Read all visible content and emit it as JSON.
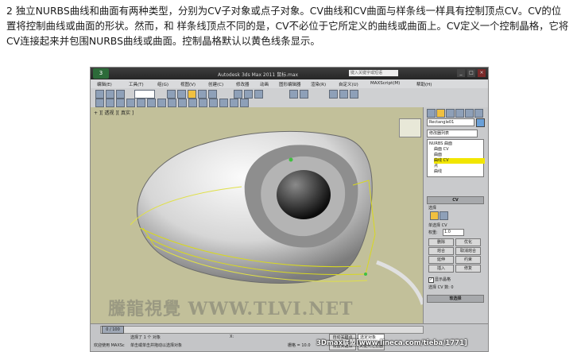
{
  "caption": "2 独立NURBS曲线和曲面有两种类型，分别为CV子对象或点子对象。CV曲线和CV曲面与样条线一样具有控制顶点CV。CV的位置将控制曲线或曲面的形状。然而，和 样条线顶点不同的是，CV不必位于它所定义的曲线或曲面上。CV定义一个控制晶格，它将CV连接起来并包围NURBS曲线或曲面。控制晶格默认以黄色线条显示。",
  "app": {
    "title": "Autodesk 3ds Max  2011     鼠标.max",
    "search_placeholder": "键入关键字或短语",
    "menus": [
      "编辑(E)",
      "工具(T)",
      "组(G)",
      "视图(V)",
      "创建(C)",
      "修改器",
      "动画",
      "图形编辑器",
      "渲染(R)",
      "自定义(U)",
      "MAXScript(M)",
      "帮助(H)"
    ],
    "viewport_label": "+ ][ 透视 ][ 真实 ]",
    "watermark": "騰龍視覺 WWW.TLVI.NET",
    "command_panel": {
      "object_name": "Rectangle01",
      "modifier_list": "修改器列表",
      "stack": [
        "NURBS 曲面",
        "曲面 CV",
        "曲面",
        "曲线 CV",
        "点",
        "曲线"
      ],
      "selected_stack_index": 3,
      "rollout_cv": "CV",
      "rollout_selection": "选择",
      "info_single": "单选择 CV",
      "weight_label": "权重:",
      "weight_value": "1.0",
      "buttons": [
        [
          "删除",
          "优化"
        ],
        [
          "熔合",
          "取消熔合"
        ],
        [
          "延伸",
          "约束"
        ],
        [
          "插入",
          "修复"
        ]
      ],
      "show_lattice": "显示晶格",
      "selected_count": "选择 CV 数: 0",
      "soft_select": "软选择"
    },
    "status": {
      "frame": "0 / 100",
      "selection": "选择了 1 个 对象",
      "prompt": "单击或单击并拖动以选择对象",
      "welcome": "欢迎使用 MAXSc",
      "x": "X:",
      "grid": "栅格 = 10.0",
      "autokey": "自动关键点",
      "setkey": "设置关键点",
      "selected_objects": "选定对象",
      "key_filter": "关键点过滤器"
    }
  },
  "footer": "3Dmax联盟[www.lineca.com/tieba/1771]"
}
